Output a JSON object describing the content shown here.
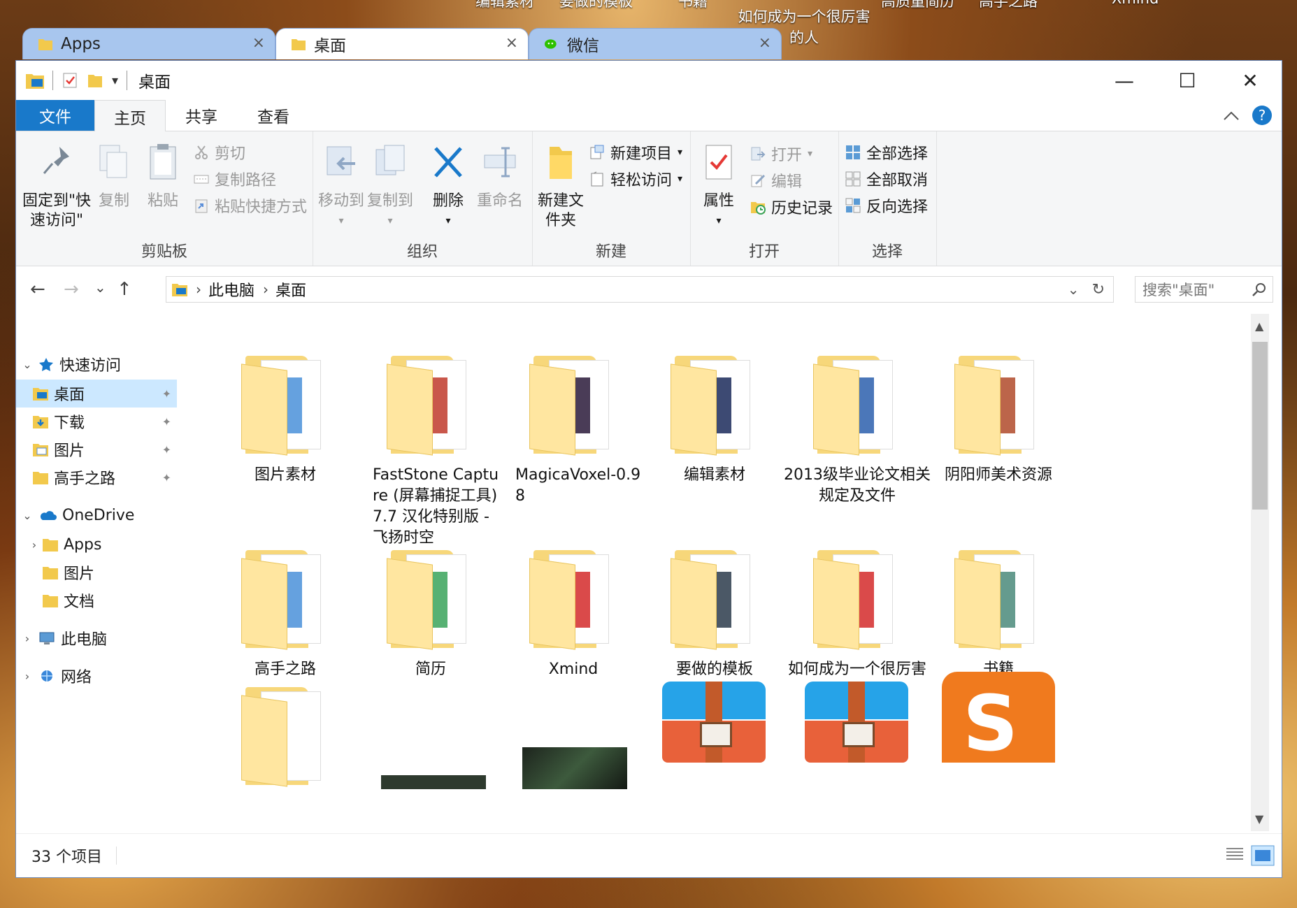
{
  "desktop_labels": [
    "编辑素材",
    "要做的模板",
    "书籍",
    "如何成为一个很厉害的人",
    "高质量简历",
    "高手之路",
    "Xmind"
  ],
  "tabs": [
    {
      "label": "Apps",
      "close": "×",
      "icon": "folder-icon"
    },
    {
      "label": "桌面",
      "close": "×",
      "icon": "folder-icon"
    },
    {
      "label": "微信",
      "close": "×",
      "icon": "wechat-icon"
    }
  ],
  "window": {
    "title": "桌面",
    "quick_access_dropdown": "▾",
    "minimize": "—",
    "maximize": "☐",
    "close": "✕"
  },
  "ribbon_tabs": [
    "文件",
    "主页",
    "共享",
    "查看"
  ],
  "ribbon": {
    "clipboard": {
      "label": "剪贴板",
      "pin": "固定到\"快速访问\"",
      "copy": "复制",
      "paste": "粘贴",
      "cut": "剪切",
      "copy_path": "复制路径",
      "paste_shortcut": "粘贴快捷方式"
    },
    "organize": {
      "label": "组织",
      "move_to": "移动到",
      "copy_to": "复制到",
      "delete": "删除",
      "rename": "重命名"
    },
    "new": {
      "label": "新建",
      "new_folder": "新建文件夹",
      "new_item": "新建项目",
      "easy_access": "轻松访问"
    },
    "open": {
      "label": "打开",
      "properties": "属性",
      "open": "打开",
      "edit": "编辑",
      "history": "历史记录"
    },
    "select": {
      "label": "选择",
      "select_all": "全部选择",
      "select_none": "全部取消",
      "invert": "反向选择"
    }
  },
  "address": {
    "back": "←",
    "forward": "→",
    "recent": "⌄",
    "up": "↑",
    "crumbs": [
      "此电脑",
      "桌面"
    ],
    "crumb_sep": "›",
    "dropdown": "⌄",
    "refresh": "↻",
    "search_placeholder": "搜索\"桌面\""
  },
  "nav": [
    {
      "label": "快速访问",
      "chev": "⌄",
      "icon": "star-icon",
      "level": 0
    },
    {
      "label": "桌面",
      "icon": "desktop-folder-icon",
      "level": 1,
      "pin": "📌",
      "selected": true
    },
    {
      "label": "下载",
      "icon": "download-folder-icon",
      "level": 1,
      "pin": "📌"
    },
    {
      "label": "图片",
      "icon": "pictures-folder-icon",
      "level": 1,
      "pin": "📌"
    },
    {
      "label": "高手之路",
      "icon": "folder-icon",
      "level": 1,
      "pin": "📌"
    },
    {
      "label": "OneDrive",
      "chev": "⌄",
      "icon": "cloud-icon",
      "level": 0
    },
    {
      "label": "Apps",
      "chev": "›",
      "icon": "folder-icon",
      "level": 1
    },
    {
      "label": "图片",
      "icon": "folder-icon",
      "level": 1
    },
    {
      "label": "文档",
      "icon": "folder-icon",
      "level": 1
    },
    {
      "label": "此电脑",
      "chev": "›",
      "icon": "computer-icon",
      "level": 0
    },
    {
      "label": "网络",
      "chev": "›",
      "icon": "network-icon",
      "level": 0
    }
  ],
  "items": [
    {
      "name": "图片素材",
      "kind": "folder",
      "accent": "#4a90d9"
    },
    {
      "name": "FastStone Capture (屏幕捕捉工具) 7.7 汉化特别版 -飞扬时空",
      "kind": "folder",
      "accent": "#c0392b"
    },
    {
      "name": "MagicaVoxel-0.98",
      "kind": "folder",
      "accent": "#2a1a3a"
    },
    {
      "name": "编辑素材",
      "kind": "folder",
      "accent": "#1b2a5a"
    },
    {
      "name": "2013级毕业论文相关规定及文件",
      "kind": "folder",
      "accent": "#2b5fad"
    },
    {
      "name": "阴阳师美术资源",
      "kind": "folder",
      "accent": "#b04a2a"
    },
    {
      "name": "高手之路",
      "kind": "folder",
      "accent": "#4a90d9"
    },
    {
      "name": "简历",
      "kind": "folder",
      "accent": "#3aa35a"
    },
    {
      "name": "Xmind",
      "kind": "folder",
      "accent": "#d42a2a"
    },
    {
      "name": "要做的模板",
      "kind": "folder",
      "accent": "#2b3b4b"
    },
    {
      "name": "如何成为一个很厉害的人",
      "kind": "folder",
      "accent": "#d42a2a"
    },
    {
      "name": "书籍",
      "kind": "folder",
      "accent": "#4a8a7a"
    }
  ],
  "status": {
    "count": "33 个项目"
  },
  "colors": {
    "accent": "#1979ca",
    "selection": "#cce8ff",
    "folder": "#f7d77a"
  }
}
